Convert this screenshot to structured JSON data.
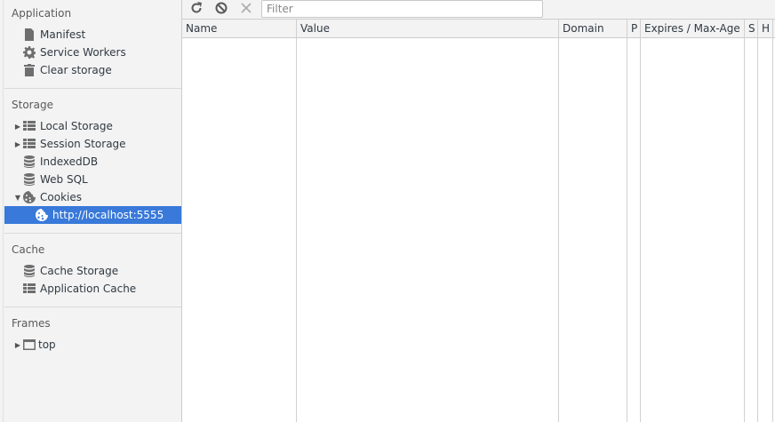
{
  "sidebar": {
    "application": {
      "title": "Application",
      "items": [
        {
          "label": "Manifest",
          "icon": "document-icon"
        },
        {
          "label": "Service Workers",
          "icon": "gear-icon"
        },
        {
          "label": "Clear storage",
          "icon": "trash-icon"
        }
      ]
    },
    "storage": {
      "title": "Storage",
      "items": [
        {
          "label": "Local Storage",
          "icon": "grid-icon"
        },
        {
          "label": "Session Storage",
          "icon": "grid-icon"
        },
        {
          "label": "IndexedDB",
          "icon": "database-icon"
        },
        {
          "label": "Web SQL",
          "icon": "database-icon"
        },
        {
          "label": "Cookies",
          "icon": "cookie-icon"
        },
        {
          "label": "http://localhost:5555",
          "icon": "cookie-icon"
        }
      ]
    },
    "cache": {
      "title": "Cache",
      "items": [
        {
          "label": "Cache Storage",
          "icon": "database-icon"
        },
        {
          "label": "Application Cache",
          "icon": "grid-icon"
        }
      ]
    },
    "frames": {
      "title": "Frames",
      "items": [
        {
          "label": "top",
          "icon": "frame-icon"
        }
      ]
    }
  },
  "toolbar": {
    "filter_placeholder": "Filter"
  },
  "table": {
    "columns": [
      "Name",
      "Value",
      "Domain",
      "P",
      "Expires / Max-Age",
      "S",
      "H"
    ]
  },
  "colors": {
    "selection": "#3879d9",
    "panel": "#f3f3f3"
  }
}
